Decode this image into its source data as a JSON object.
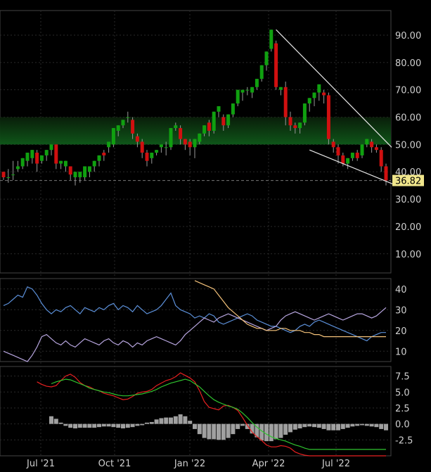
{
  "chart_data": [
    {
      "type": "candlestick",
      "xlabels": [
        "Jul '21",
        "Oct '21",
        "Jan '22",
        "Apr '22",
        "Jul '22"
      ],
      "y_ticks": [
        "90.00",
        "80.00",
        "70.00",
        "60.00",
        "50.00",
        "40.00",
        "30.00",
        "20.00",
        "10.00"
      ],
      "ylim": [
        3,
        99
      ],
      "grid": true,
      "last_price_label": "36.82",
      "colors": {
        "up": "#10a010",
        "down": "#d01010",
        "band": "#0f5a1a",
        "trendline": "#e8e8e8",
        "last_price_bg": "#f0e68c"
      },
      "highlight_band": [
        50,
        60
      ],
      "last_price": 36.82,
      "candles": [
        [
          40,
          40,
          38,
          37
        ],
        [
          38,
          41,
          38,
          36
        ],
        [
          39,
          44,
          39,
          37
        ],
        [
          41,
          44,
          42,
          40
        ],
        [
          42,
          44,
          45,
          41
        ],
        [
          44,
          46,
          47,
          42
        ],
        [
          45,
          46,
          48,
          43
        ],
        [
          47,
          48,
          43,
          40
        ],
        [
          44,
          45,
          46,
          43
        ],
        [
          46,
          47,
          48,
          44
        ],
        [
          48,
          49,
          50,
          46
        ],
        [
          50,
          50,
          43,
          41
        ],
        [
          43,
          44,
          44,
          41
        ],
        [
          42,
          43,
          44,
          40
        ],
        [
          42,
          42,
          39,
          37
        ],
        [
          38,
          39,
          40,
          35
        ],
        [
          38,
          39,
          40,
          36
        ],
        [
          38,
          39,
          42,
          37
        ],
        [
          40,
          41,
          42,
          38
        ],
        [
          42,
          43,
          44,
          40
        ],
        [
          44,
          45,
          46,
          42
        ],
        [
          47,
          48,
          46,
          44
        ],
        [
          49,
          51,
          51,
          47
        ],
        [
          50,
          51,
          56,
          49
        ],
        [
          55,
          56,
          57,
          53
        ],
        [
          57,
          59,
          59,
          56
        ],
        [
          60,
          62,
          60,
          58
        ],
        [
          59,
          60,
          54,
          52
        ],
        [
          53,
          54,
          51,
          49
        ],
        [
          51,
          52,
          47,
          45
        ],
        [
          47,
          48,
          44,
          42
        ],
        [
          45,
          46,
          47,
          43
        ],
        [
          47,
          48,
          48,
          46
        ],
        [
          49,
          50,
          50,
          47
        ],
        [
          49,
          51,
          49,
          46
        ],
        [
          49,
          50,
          56,
          48
        ],
        [
          56,
          58,
          57,
          55
        ],
        [
          56,
          57,
          52,
          50
        ],
        [
          52,
          52,
          50,
          48
        ],
        [
          51,
          52,
          49,
          46
        ],
        [
          49,
          50,
          52,
          45
        ],
        [
          51,
          52,
          54,
          50
        ],
        [
          54,
          55,
          57,
          53
        ],
        [
          58,
          59,
          55,
          53
        ],
        [
          55,
          56,
          62,
          54
        ],
        [
          62,
          63,
          64,
          60
        ],
        [
          60,
          61,
          57,
          55
        ],
        [
          57,
          58,
          61,
          56
        ],
        [
          61,
          62,
          65,
          60
        ],
        [
          65,
          66,
          70,
          64
        ],
        [
          69,
          70,
          70,
          66
        ],
        [
          70,
          71,
          70,
          68
        ],
        [
          69,
          70,
          71,
          67
        ],
        [
          71,
          72,
          74,
          70
        ],
        [
          74,
          75,
          79,
          73
        ],
        [
          79,
          80,
          84,
          77
        ],
        [
          85,
          86,
          92,
          84
        ],
        [
          87,
          88,
          71,
          70
        ],
        [
          70,
          71,
          71,
          68
        ],
        [
          71,
          73,
          60,
          57
        ],
        [
          60,
          62,
          57,
          55
        ],
        [
          57,
          58,
          56,
          54
        ],
        [
          56,
          58,
          58,
          54
        ],
        [
          58,
          59,
          65,
          57
        ],
        [
          65,
          66,
          67,
          62
        ],
        [
          67,
          68,
          69,
          64
        ],
        [
          69,
          70,
          72,
          66
        ],
        [
          69,
          70,
          68,
          65
        ],
        [
          68,
          69,
          52,
          50
        ],
        [
          51,
          52,
          49,
          47
        ],
        [
          49,
          50,
          46,
          43
        ],
        [
          46,
          47,
          43,
          42
        ],
        [
          43,
          44,
          45,
          41
        ],
        [
          45,
          46,
          47,
          44
        ],
        [
          47,
          48,
          45,
          44
        ],
        [
          46,
          47,
          50,
          45
        ],
        [
          50,
          51,
          52,
          49
        ],
        [
          51,
          52,
          49,
          47
        ],
        [
          49,
          50,
          48,
          47
        ],
        [
          48,
          49,
          42,
          40
        ],
        [
          42,
          43,
          36.82,
          35
        ]
      ],
      "trendlines": [
        {
          "p1": [
            57,
            92
          ],
          "p2": [
            80,
            49
          ]
        },
        {
          "p1": [
            64,
            48
          ],
          "p2": [
            81,
            35
          ]
        }
      ]
    },
    {
      "type": "line",
      "yticks": [
        "40",
        "30",
        "20",
        "10"
      ],
      "ylim": [
        5,
        45
      ],
      "grid": true,
      "series": [
        {
          "color": "#5b8fd8",
          "values": [
            32,
            33,
            35,
            37,
            36,
            41,
            40,
            37,
            33,
            30,
            28,
            30,
            29,
            31,
            32,
            30,
            28,
            31,
            30,
            29,
            31,
            30,
            32,
            33,
            30,
            32,
            31,
            29,
            32,
            30,
            28,
            29,
            30,
            32,
            35,
            38,
            32,
            30,
            29,
            28,
            26,
            27,
            26,
            28,
            27,
            24,
            23,
            24,
            25,
            26,
            27,
            28,
            27,
            25,
            24,
            23,
            22,
            22,
            21,
            20,
            19,
            20,
            22,
            23,
            22,
            24,
            25,
            24,
            23,
            22,
            21,
            20,
            19,
            18,
            17,
            16,
            15,
            17,
            18,
            19,
            19
          ]
        },
        {
          "color": "#b8a6e0",
          "values": [
            10,
            9,
            8,
            7,
            6,
            5,
            8,
            12,
            17,
            18,
            16,
            14,
            13,
            15,
            13,
            12,
            14,
            16,
            15,
            14,
            13,
            15,
            16,
            14,
            13,
            15,
            14,
            12,
            14,
            13,
            15,
            16,
            17,
            16,
            15,
            14,
            13,
            15,
            18,
            20,
            22,
            24,
            26,
            25,
            24,
            26,
            27,
            28,
            27,
            26,
            25,
            24,
            23,
            22,
            21,
            20,
            21,
            22,
            25,
            27,
            28,
            29,
            28,
            27,
            26,
            25,
            26,
            27,
            28,
            27,
            26,
            25,
            26,
            27,
            28,
            28,
            27,
            26,
            27,
            29,
            31
          ]
        },
        {
          "color": "#f4c27a",
          "values": [
            null,
            null,
            null,
            null,
            null,
            null,
            null,
            null,
            null,
            null,
            null,
            null,
            null,
            null,
            null,
            null,
            null,
            null,
            null,
            null,
            null,
            null,
            null,
            null,
            null,
            null,
            null,
            null,
            null,
            null,
            null,
            null,
            null,
            null,
            null,
            null,
            null,
            null,
            null,
            null,
            44,
            43,
            42,
            41,
            40,
            37,
            34,
            31,
            29,
            27,
            25,
            23,
            22,
            21,
            21,
            20,
            20,
            20,
            21,
            21,
            20,
            20,
            20,
            19,
            19,
            18,
            18,
            17,
            17,
            17,
            17,
            17,
            17,
            17,
            17,
            17,
            17,
            17,
            17,
            17,
            17
          ]
        }
      ]
    },
    {
      "type": "line+histogram",
      "yticks": [
        "7.5",
        "5.0",
        "2.5",
        "0.0",
        "-2.5"
      ],
      "ylim": [
        -5,
        9
      ],
      "grid": true,
      "bar_color": "#a0a0a0",
      "series": [
        {
          "color": "#e82020",
          "values": [
            null,
            null,
            null,
            null,
            null,
            null,
            null,
            6.6,
            6.2,
            5.9,
            5.8,
            6.0,
            6.8,
            7.5,
            7.8,
            7.3,
            6.5,
            6.0,
            5.8,
            5.4,
            5.2,
            4.8,
            4.6,
            4.4,
            4.1,
            3.8,
            3.9,
            4.3,
            4.8,
            5.0,
            5.1,
            5.4,
            6.0,
            6.4,
            6.8,
            7.0,
            7.4,
            8.0,
            7.6,
            7.2,
            6.6,
            5.2,
            3.5,
            2.6,
            2.4,
            2.2,
            2.8,
            2.9,
            2.6,
            2.1,
            1.0,
            -0.2,
            -1.3,
            -2.0,
            -2.6,
            -3.3,
            -3.6,
            -3.6,
            -3.4,
            -3.5,
            -3.8,
            -4.4,
            -4.7,
            -4.9,
            -5.0,
            -5.0,
            -5.0,
            -5.0,
            -5.0,
            -5.0,
            -5.0,
            -5.0,
            -5.0,
            -5.0,
            -5.0,
            -5.0,
            -5.0,
            -5.0,
            -5.0,
            -5.0,
            -5.0
          ]
        },
        {
          "color": "#2fc42f",
          "values": [
            null,
            null,
            null,
            null,
            null,
            null,
            null,
            null,
            null,
            null,
            6.3,
            6.6,
            6.8,
            7.0,
            6.9,
            6.6,
            6.3,
            6.0,
            5.6,
            5.4,
            5.2,
            5.0,
            4.9,
            4.7,
            4.5,
            4.4,
            4.4,
            4.5,
            4.6,
            4.7,
            4.9,
            5.1,
            5.4,
            5.8,
            6.1,
            6.4,
            6.6,
            6.8,
            7.0,
            6.8,
            6.3,
            5.8,
            5.1,
            4.4,
            3.8,
            3.4,
            3.1,
            2.8,
            2.6,
            2.3,
            1.7,
            1.0,
            0.2,
            -0.5,
            -1.1,
            -1.6,
            -2.0,
            -2.3,
            -2.5,
            -2.7,
            -3.0,
            -3.3,
            -3.5,
            -3.8,
            -4.0,
            -4.0,
            -4.0,
            -4.0,
            -4.0,
            -4.0,
            -4.0,
            -4.0,
            -4.0,
            -4.0,
            -4.0,
            -4.0,
            -4.0,
            -4.0,
            -4.0,
            -4.0,
            -4.0
          ]
        },
        {
          "color": "#a0a0a0",
          "values": [
            null,
            null,
            null,
            null,
            null,
            null,
            null,
            null,
            null,
            null,
            1.2,
            0.8,
            0.2,
            -0.3,
            -0.6,
            -0.7,
            -0.6,
            -0.6,
            -0.6,
            -0.6,
            -0.5,
            -0.4,
            -0.4,
            -0.5,
            -0.6,
            -0.7,
            -0.6,
            -0.5,
            -0.3,
            -0.2,
            0.2,
            0.3,
            0.7,
            0.9,
            1.0,
            1.0,
            1.2,
            1.5,
            1.2,
            0.5,
            -0.8,
            -1.6,
            -2.2,
            -2.4,
            -2.4,
            -2.5,
            -2.5,
            -2.2,
            -1.6,
            -0.8,
            -0.3,
            -0.8,
            -1.5,
            -2.1,
            -2.6,
            -2.7,
            -2.7,
            -2.4,
            -2.2,
            -1.7,
            -1.3,
            -0.9,
            -0.7,
            -0.5,
            -0.4,
            -0.5,
            -0.6,
            -0.8,
            -1.0,
            -1.0,
            -1.0,
            -0.8,
            -0.6,
            -0.4,
            -0.3,
            -0.2,
            -0.3,
            -0.4,
            -0.5,
            -0.8,
            -1.0
          ]
        }
      ]
    }
  ]
}
